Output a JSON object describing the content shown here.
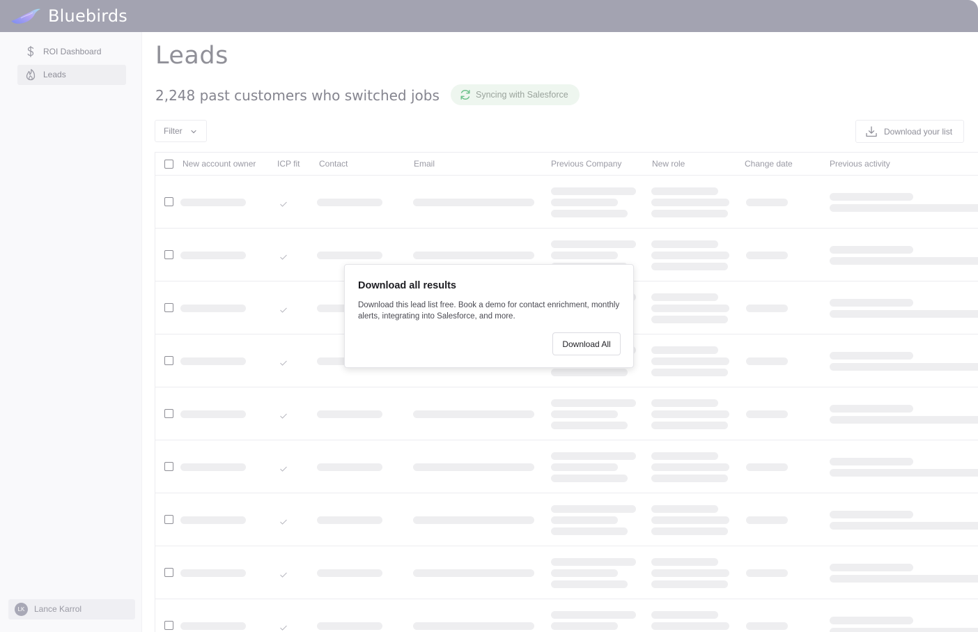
{
  "app": {
    "brand": "Bluebirds"
  },
  "sidebar": {
    "items": [
      {
        "label": "ROI Dashboard",
        "icon": "dollar-icon",
        "active": false
      },
      {
        "label": "Leads",
        "icon": "flame-icon",
        "active": true
      }
    ],
    "user": {
      "initials": "LK",
      "name": "Lance Karrol"
    }
  },
  "main": {
    "title": "Leads",
    "subtitle": "2,248 past customers who switched jobs",
    "sync_status": "Syncing with Salesforce",
    "filter_label": "Filter",
    "download_list_label": "Download your list"
  },
  "table": {
    "columns": [
      "New account owner",
      "ICP fit",
      "Contact",
      "Email",
      "Previous Company",
      "New role",
      "Change date",
      "Previous activity"
    ],
    "row_count": 9
  },
  "modal": {
    "title": "Download all results",
    "body": "Download this lead list free. Book a demo for contact enrichment, monthly alerts, integrating into Salesforce, and more.",
    "button_label": "Download All"
  },
  "colors": {
    "topbar": "#a3a3b1",
    "sync_green": "#6cc08a",
    "skeleton": "#eeeef0"
  }
}
